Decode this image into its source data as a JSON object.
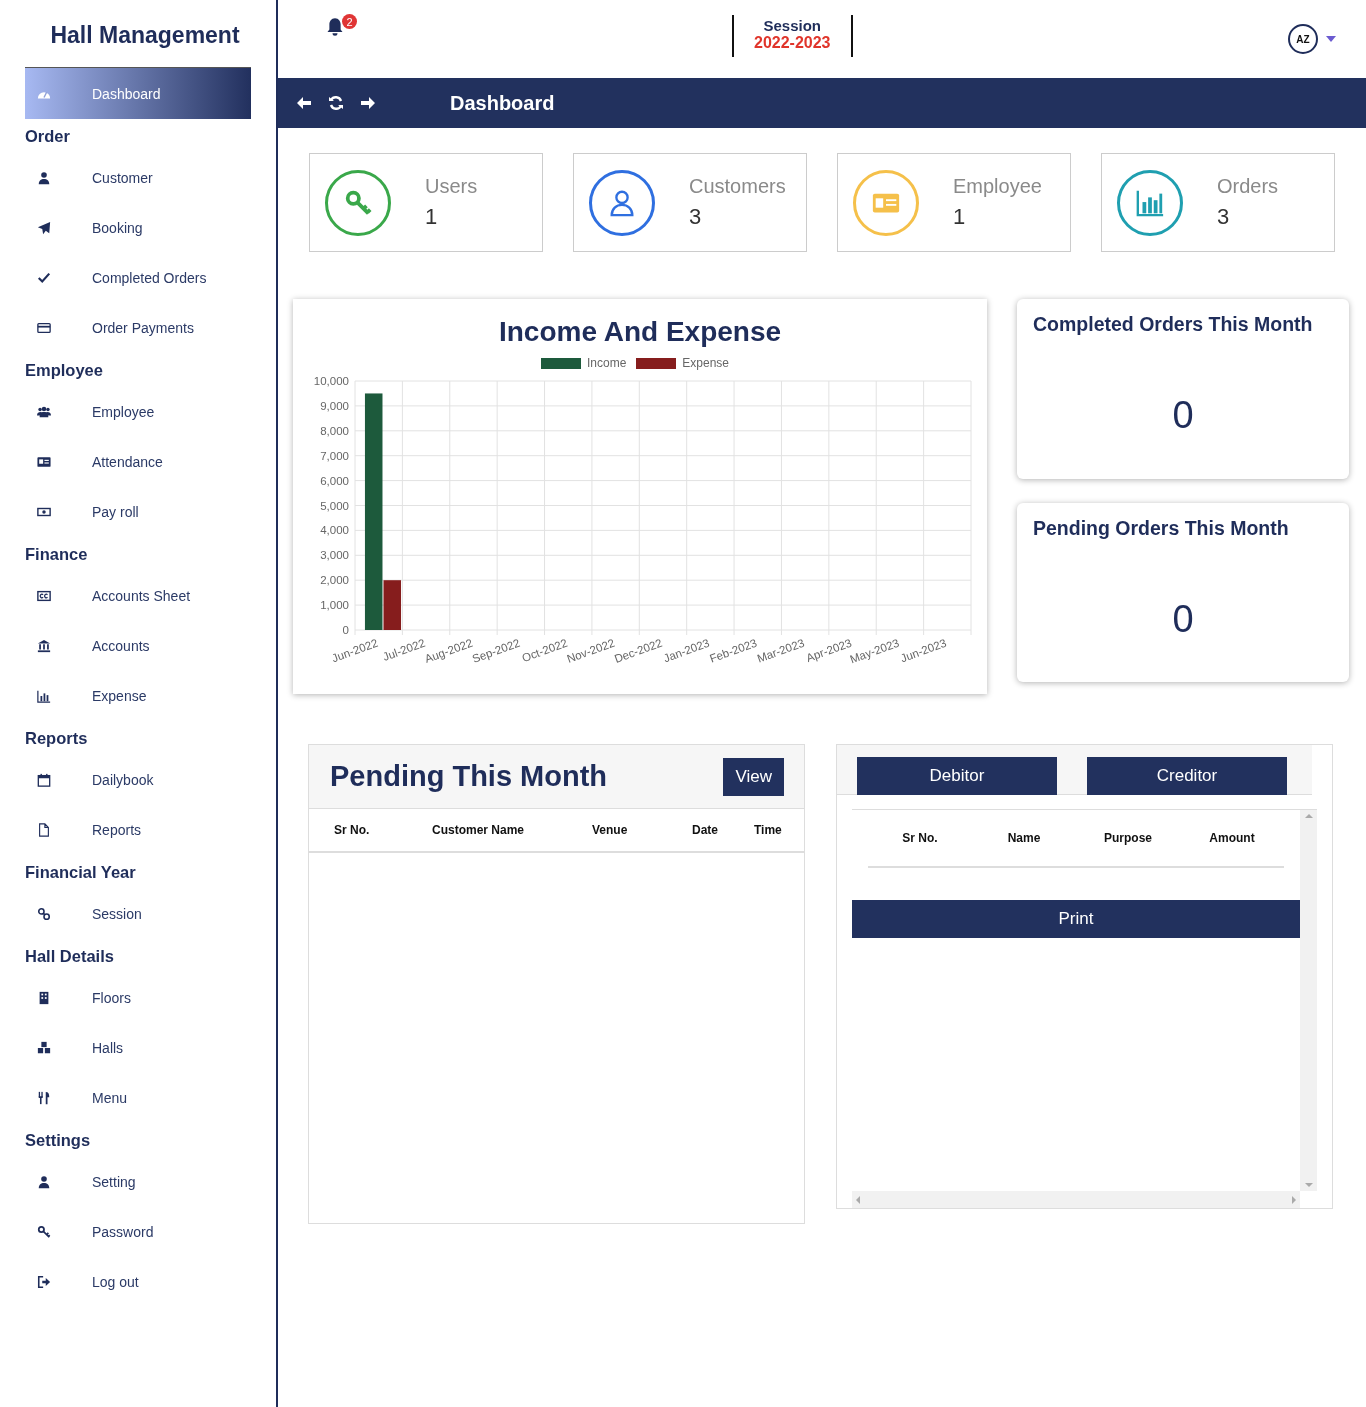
{
  "sidebar": {
    "title": "Hall Management",
    "items": [
      {
        "kind": "item",
        "label": "Dashboard",
        "selected": true
      },
      {
        "kind": "heading",
        "label": "Order"
      },
      {
        "kind": "item",
        "label": "Customer",
        "selected": false
      },
      {
        "kind": "item",
        "label": "Booking",
        "selected": false
      },
      {
        "kind": "item",
        "label": "Completed Orders",
        "selected": false
      },
      {
        "kind": "item",
        "label": "Order Payments",
        "selected": false
      },
      {
        "kind": "heading",
        "label": "Employee"
      },
      {
        "kind": "item",
        "label": "Employee",
        "selected": false
      },
      {
        "kind": "item",
        "label": "Attendance",
        "selected": false
      },
      {
        "kind": "item",
        "label": "Pay roll",
        "selected": false
      },
      {
        "kind": "heading",
        "label": "Finance"
      },
      {
        "kind": "item",
        "label": "Accounts Sheet",
        "selected": false
      },
      {
        "kind": "item",
        "label": "Accounts",
        "selected": false
      },
      {
        "kind": "item",
        "label": "Expense",
        "selected": false
      },
      {
        "kind": "heading",
        "label": "Reports"
      },
      {
        "kind": "item",
        "label": "Dailybook",
        "selected": false
      },
      {
        "kind": "item",
        "label": "Reports",
        "selected": false
      },
      {
        "kind": "heading",
        "label": "Financial Year"
      },
      {
        "kind": "item",
        "label": "Session",
        "selected": false
      },
      {
        "kind": "heading",
        "label": "Hall Details"
      },
      {
        "kind": "item",
        "label": "Floors",
        "selected": false
      },
      {
        "kind": "item",
        "label": "Halls",
        "selected": false
      },
      {
        "kind": "item",
        "label": "Menu",
        "selected": false
      },
      {
        "kind": "heading",
        "label": "Settings"
      },
      {
        "kind": "item",
        "label": "Setting",
        "selected": false
      },
      {
        "kind": "item",
        "label": "Password",
        "selected": false
      },
      {
        "kind": "item",
        "label": "Log out",
        "selected": false
      }
    ]
  },
  "header": {
    "notification_count": "2",
    "session_label": "Session",
    "session_value": "2022-2023",
    "avatar_logo": "AZ"
  },
  "page_bar": {
    "title": "Dashboard"
  },
  "stats": [
    {
      "label": "Users",
      "value": "1",
      "color": "#3aa84a"
    },
    {
      "label": "Customers",
      "value": "3",
      "color": "#2f6fe0"
    },
    {
      "label": "Employee",
      "value": "1",
      "color": "#f5c04a"
    },
    {
      "label": "Orders",
      "value": "3",
      "color": "#1f9fb0"
    }
  ],
  "income_chart": {
    "title": "Income And Expense",
    "chart_data": {
      "type": "bar",
      "categories": [
        "Jun-2022",
        "Jul-2022",
        "Aug-2022",
        "Sep-2022",
        "Oct-2022",
        "Nov-2022",
        "Dec-2022",
        "Jan-2023",
        "Feb-2023",
        "Mar-2023",
        "Apr-2023",
        "May-2023",
        "Jun-2023"
      ],
      "series": [
        {
          "name": "Income",
          "color": "#1d5a3c",
          "values": [
            9500,
            0,
            0,
            0,
            0,
            0,
            0,
            0,
            0,
            0,
            0,
            0,
            0
          ]
        },
        {
          "name": "Expense",
          "color": "#861d1d",
          "values": [
            2000,
            0,
            0,
            0,
            0,
            0,
            0,
            0,
            0,
            0,
            0,
            0,
            0
          ]
        }
      ],
      "grid": true,
      "ylim": [
        0,
        10000
      ],
      "yticks": [
        {
          "value": 0,
          "label": "0"
        },
        {
          "value": 1000,
          "label": "1,000"
        },
        {
          "value": 2000,
          "label": "2,000"
        },
        {
          "value": 3000,
          "label": "3,000"
        },
        {
          "value": 4000,
          "label": "4,000"
        },
        {
          "value": 5000,
          "label": "5,000"
        },
        {
          "value": 6000,
          "label": "6,000"
        },
        {
          "value": 7000,
          "label": "7,000"
        },
        {
          "value": 8000,
          "label": "8,000"
        },
        {
          "value": 9000,
          "label": "9,000"
        },
        {
          "value": 10000,
          "label": "10,000"
        }
      ]
    }
  },
  "month_cards": [
    {
      "title": "Completed Orders This Month",
      "value": "0"
    },
    {
      "title": "Pending Orders This Month",
      "value": "0"
    }
  ],
  "pending_panel": {
    "title": "Pending This Month",
    "button": "View",
    "columns": [
      "Sr No.",
      "Customer Name",
      "Venue",
      "Date",
      "Time"
    ]
  },
  "ledger_panel": {
    "buttons": [
      "Debitor",
      "Creditor"
    ],
    "columns": [
      "Sr No.",
      "Name",
      "Purpose",
      "Amount"
    ],
    "print_button": "Print"
  }
}
